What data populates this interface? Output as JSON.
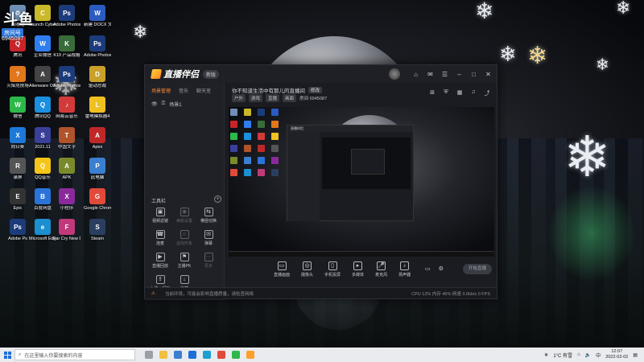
{
  "watermark": {
    "logo": "斗鱼",
    "badge": "房间号",
    "room_number": "6945087"
  },
  "desktop_icons": [
    {
      "label": "回收站",
      "color": "#6f8fb5",
      "glyph": "♻"
    },
    {
      "label": "Launch Cyberpunk",
      "color": "#c9b82a",
      "glyph": "C"
    },
    {
      "label": "Adobe Photosh...",
      "color": "#1c3b7a",
      "glyph": "Ps"
    },
    {
      "label": "新建 DOCX 文档",
      "color": "#2a5bbf",
      "glyph": "W"
    },
    {
      "label": "腾讯",
      "color": "#c8242a",
      "glyph": "Q"
    },
    {
      "label": "企业微信",
      "color": "#2f7ef0",
      "glyph": "W"
    },
    {
      "label": "K10 产品规格",
      "color": "#3a6b3a",
      "glyph": "K"
    },
    {
      "label": "Adobe Photosh...",
      "color": "#1c3b7a",
      "glyph": "Ps"
    },
    {
      "label": "火焰竞技场",
      "color": "#e0771a",
      "glyph": "?"
    },
    {
      "label": "Alienware OS Rec...",
      "color": "#444",
      "glyph": "A"
    },
    {
      "label": "Adobe Photosh...",
      "color": "#1c3b7a",
      "glyph": "Ps"
    },
    {
      "label": "驱动总裁",
      "color": "#c9a12a",
      "glyph": "D"
    },
    {
      "label": "微信",
      "color": "#2db84a",
      "glyph": "W"
    },
    {
      "label": "腾讯QQ",
      "color": "#1b8fe0",
      "glyph": "Q"
    },
    {
      "label": "网易云音乐",
      "color": "#d23a3a",
      "glyph": "♪"
    },
    {
      "label": "雷电模拟器4",
      "color": "#f0c020",
      "glyph": "L"
    },
    {
      "label": "向日葵",
      "color": "#1d78d8",
      "glyph": "X"
    },
    {
      "label": "2021.11",
      "color": "#3a3f9a",
      "glyph": "S"
    },
    {
      "label": "中国文字",
      "color": "#b0532a",
      "glyph": "T"
    },
    {
      "label": "Apex",
      "color": "#c02828",
      "glyph": "A"
    },
    {
      "label": "录屏",
      "color": "#555",
      "glyph": "R"
    },
    {
      "label": "QQ音乐",
      "color": "#f5c518",
      "glyph": "Q"
    },
    {
      "label": "APK",
      "color": "#7a8a2a",
      "glyph": "A"
    },
    {
      "label": "此电脑",
      "color": "#3a7fd0",
      "glyph": "P"
    },
    {
      "label": "Epic",
      "color": "#333",
      "glyph": "E"
    },
    {
      "label": "百度网盘",
      "color": "#2a74d9",
      "glyph": "B"
    },
    {
      "label": "小程序",
      "color": "#8a2a9a",
      "glyph": "X"
    },
    {
      "label": "Google Chrome",
      "color": "#e04a3a",
      "glyph": "G"
    },
    {
      "label": "Adobe Ps",
      "color": "#1c3b7a",
      "glyph": "Ps"
    },
    {
      "label": "Microsoft Edge",
      "color": "#1b8fd0",
      "glyph": "e"
    },
    {
      "label": "Far Cry New Dawn",
      "color": "#c03a7a",
      "glyph": "F"
    },
    {
      "label": "Steam",
      "color": "#2a3f5f",
      "glyph": "S"
    }
  ],
  "app": {
    "name": "直播伴侣",
    "version": "新版",
    "side_tabs": [
      "场景管理",
      "音乐",
      "聊天室"
    ],
    "scene": "场景1",
    "tools_title": "工具栏",
    "tools": [
      {
        "label": "视频滤镜",
        "icon": "▣",
        "dim": false
      },
      {
        "label": "美颜设置",
        "icon": "◉",
        "dim": true
      },
      {
        "label": "横竖切换",
        "icon": "⇆",
        "dim": false
      },
      {
        "label": "连麦",
        "icon": "☎",
        "dim": false
      },
      {
        "label": "虚拟形象",
        "icon": "☺",
        "dim": true
      },
      {
        "label": "弹幕",
        "icon": "✉",
        "dim": false
      },
      {
        "label": "直播回放",
        "icon": "▶",
        "dim": false
      },
      {
        "label": "主播PK",
        "icon": "⚑",
        "dim": false
      },
      {
        "label": "更多",
        "icon": "⋯",
        "dim": true
      },
      {
        "label": "上传一起玩",
        "icon": "⇪",
        "dim": false
      },
      {
        "label": "下载",
        "icon": "↓",
        "dim": false
      }
    ],
    "main_title": "你不知道生活中有那儿的直播间",
    "main_tag": "修改",
    "sub_pills": [
      "户外",
      "游戏",
      "直播",
      "画面"
    ],
    "sub_text": "房间 6945087",
    "bottom_tools": [
      {
        "label": "直播画面",
        "icon": "▭"
      },
      {
        "label": "摄像头",
        "icon": "◎"
      },
      {
        "label": "手机投屏",
        "icon": "▯"
      },
      {
        "label": "多媒体",
        "icon": "▸"
      },
      {
        "label": "麦克风",
        "icon": "🎤"
      },
      {
        "label": "扬声器",
        "icon": "♪"
      }
    ],
    "live_button": "开始直播",
    "status_text": "当前环境，可能会影响直播质量，请检查网络",
    "status_stats": "CPU 12%   内存 46%   网速 0.0kb/s   0 FPS"
  },
  "taskbar": {
    "search_placeholder": "在这里输入你要搜索的内容",
    "temperature": "1°C 有雪",
    "lang": "中",
    "time": "12:07",
    "date": "2022-02-02"
  }
}
